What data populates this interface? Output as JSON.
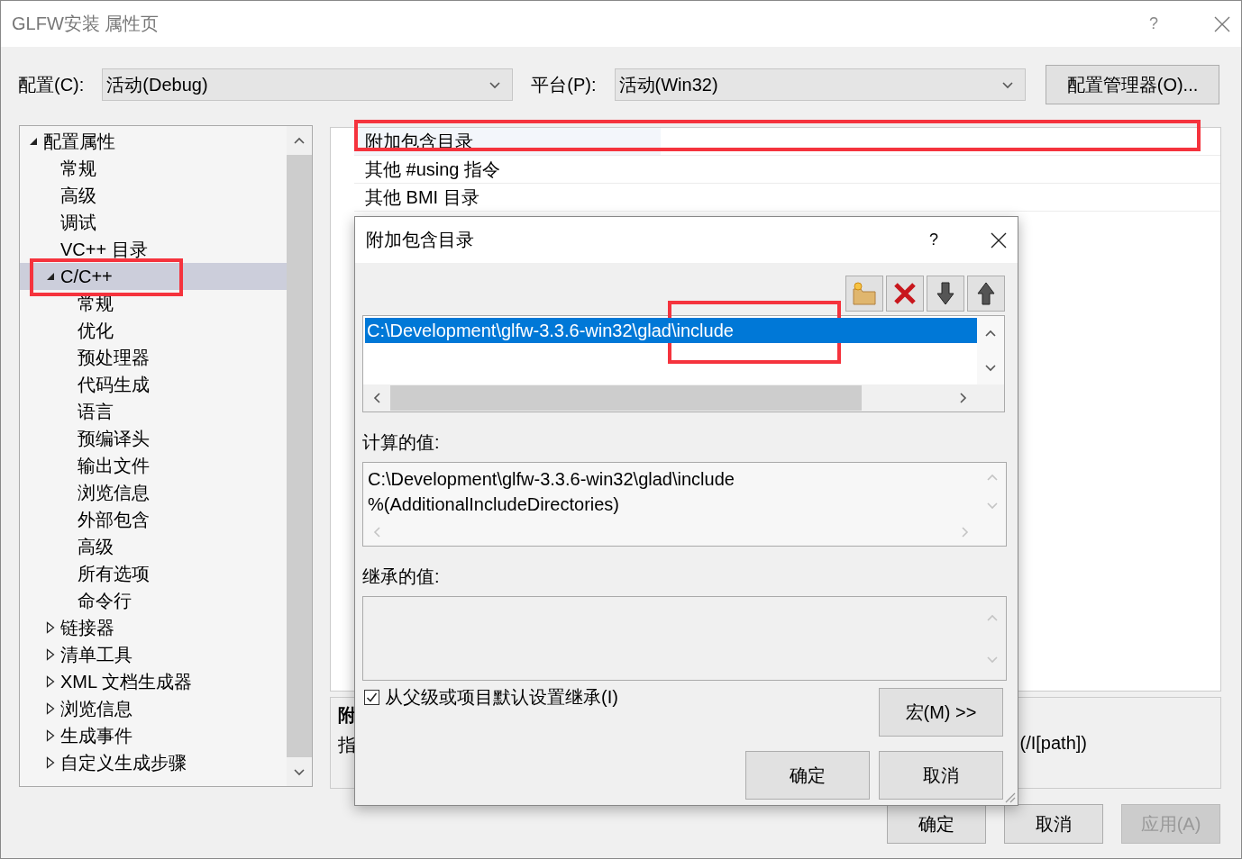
{
  "window": {
    "title": "GLFW安装 属性页",
    "help": "?"
  },
  "config": {
    "label": "配置(C):",
    "value": "活动(Debug)"
  },
  "platform": {
    "label": "平台(P):",
    "value": "活动(Win32)"
  },
  "config_manager_button": "配置管理器(O)...",
  "tree": [
    {
      "label": "配置属性",
      "expanded": true,
      "selected": false,
      "children": [
        {
          "label": "常规",
          "selected": false
        },
        {
          "label": "高级",
          "selected": false
        },
        {
          "label": "调试",
          "selected": false
        },
        {
          "label": "VC++ 目录",
          "selected": false
        },
        {
          "label": "C/C++",
          "expanded": true,
          "selected": true,
          "children": [
            {
              "label": "常规",
              "selected": false
            },
            {
              "label": "优化",
              "selected": false
            },
            {
              "label": "预处理器",
              "selected": false
            },
            {
              "label": "代码生成",
              "selected": false
            },
            {
              "label": "语言",
              "selected": false
            },
            {
              "label": "预编译头",
              "selected": false
            },
            {
              "label": "输出文件",
              "selected": false
            },
            {
              "label": "浏览信息",
              "selected": false
            },
            {
              "label": "外部包含",
              "selected": false
            },
            {
              "label": "高级",
              "selected": false
            },
            {
              "label": "所有选项",
              "selected": false
            },
            {
              "label": "命令行",
              "selected": false
            }
          ]
        },
        {
          "label": "链接器",
          "expanded": false,
          "selected": false
        },
        {
          "label": "清单工具",
          "expanded": false,
          "selected": false
        },
        {
          "label": "XML 文档生成器",
          "expanded": false,
          "selected": false
        },
        {
          "label": "浏览信息",
          "expanded": false,
          "selected": false
        },
        {
          "label": "生成事件",
          "expanded": false,
          "selected": false
        },
        {
          "label": "自定义生成步骤",
          "expanded": false,
          "selected": false
        }
      ]
    }
  ],
  "properties": [
    {
      "name": "附加包含目录",
      "selected": true
    },
    {
      "name": "其他 #using 指令",
      "selected": false
    },
    {
      "name": "其他 BMI 目录",
      "selected": false
    }
  ],
  "description": {
    "title": "附",
    "text": "指",
    "suffix": "(/I[path])"
  },
  "buttons": [
    {
      "label": "确定",
      "disabled": false
    },
    {
      "label": "取消",
      "disabled": false
    },
    {
      "label": "应用(A)",
      "disabled": true
    }
  ],
  "dialog": {
    "title": "附加包含目录",
    "help": "?",
    "entries": [
      {
        "text": "C:\\Development\\glfw-3.3.6-win32\\glad\\include",
        "selected": true
      }
    ],
    "computed_label": "计算的值:",
    "computed_lines": [
      "C:\\Development\\glfw-3.3.6-win32\\glad\\include",
      "%(AdditionalIncludeDirectories)"
    ],
    "inherited_label": "继承的值:",
    "inherit_checkbox": {
      "label": "从父级或项目默认设置继承(I)",
      "checked": true
    },
    "macro_button": "宏(M) >>",
    "buttons": [
      "确定",
      "取消"
    ]
  },
  "highlights": [
    {
      "kind": "frame"
    },
    {
      "kind": "frame"
    },
    {
      "kind": "frame"
    }
  ]
}
